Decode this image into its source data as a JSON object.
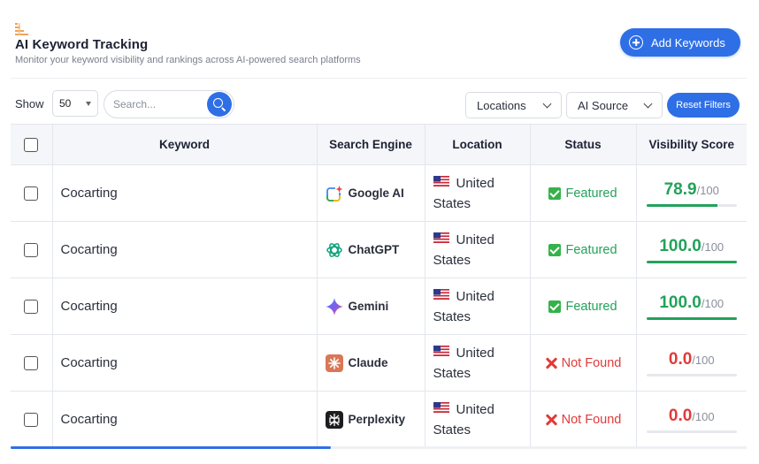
{
  "header": {
    "logo_icon": "chart-bars-icon",
    "title": "AI Keyword Tracking",
    "subtitle": "Monitor your keyword visibility and rankings across AI-powered search platforms",
    "add_button_label": "Add Keywords",
    "add_button_icon": "plus-circle-icon"
  },
  "toolbar": {
    "show_label": "Show",
    "show_value": "50",
    "search_placeholder": "Search...",
    "locations_label": "Locations",
    "source_label": "AI Source",
    "reset_label": "Reset Filters"
  },
  "table": {
    "columns": [
      "Keyword",
      "Search Engine",
      "Location",
      "Status",
      "Visibility Score"
    ],
    "rows": [
      {
        "keyword": "Cocarting",
        "engine": "Google AI",
        "engine_icon": "google-ai-icon",
        "location": "United States",
        "status": "Featured",
        "score": "78.9",
        "score_pct": 0.789,
        "max": "/100"
      },
      {
        "keyword": "Cocarting",
        "engine": "ChatGPT",
        "engine_icon": "chatgpt-icon",
        "location": "United States",
        "status": "Featured",
        "score": "100.0",
        "score_pct": 1.0,
        "max": "/100"
      },
      {
        "keyword": "Cocarting",
        "engine": "Gemini",
        "engine_icon": "gemini-icon",
        "location": "United States",
        "status": "Featured",
        "score": "100.0",
        "score_pct": 1.0,
        "max": "/100"
      },
      {
        "keyword": "Cocarting",
        "engine": "Claude",
        "engine_icon": "claude-icon",
        "location": "United States",
        "status": "Not Found",
        "score": "0.0",
        "score_pct": 0.0,
        "max": "/100"
      },
      {
        "keyword": "Cocarting",
        "engine": "Perplexity",
        "engine_icon": "perplexity-icon",
        "location": "United States",
        "status": "Not Found",
        "score": "0.0",
        "score_pct": 0.0,
        "max": "/100"
      }
    ]
  },
  "colors": {
    "accent": "#2f6fe6",
    "featured": "#22a25a",
    "not_found": "#e03a3a"
  }
}
